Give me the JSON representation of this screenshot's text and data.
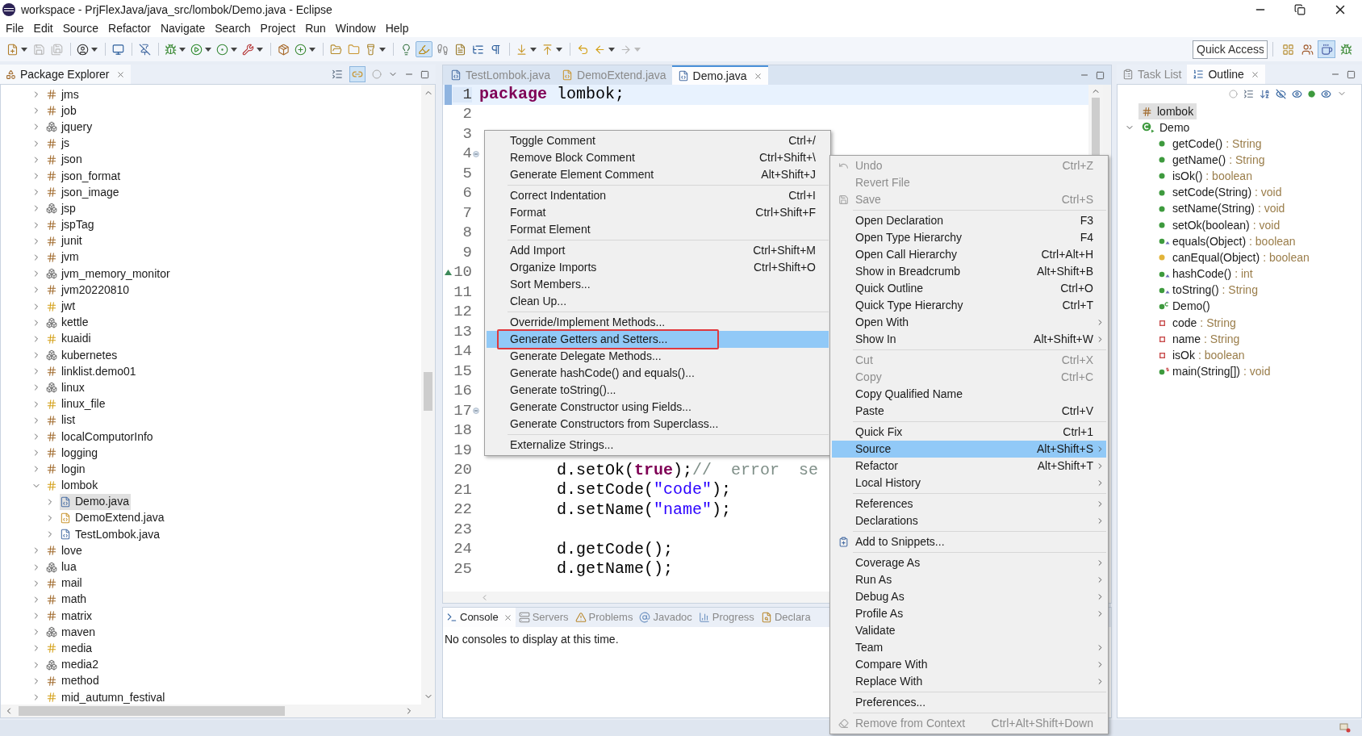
{
  "window": {
    "title": "workspace - PrjFlexJava/java_src/lombok/Demo.java - Eclipse"
  },
  "menu_bar": [
    "File",
    "Edit",
    "Source",
    "Refactor",
    "Navigate",
    "Search",
    "Project",
    "Run",
    "Window",
    "Help"
  ],
  "toolbar": [
    [
      {
        "kind": "new",
        "dropdown": true,
        "pressed": false,
        "disabled": false
      },
      {
        "kind": "save",
        "dropdown": false,
        "pressed": false,
        "disabled": true
      },
      {
        "kind": "save-all",
        "dropdown": false,
        "pressed": false,
        "disabled": true
      }
    ],
    [
      {
        "kind": "profile",
        "dropdown": true,
        "pressed": false,
        "disabled": false
      }
    ],
    [
      {
        "kind": "monitor",
        "dropdown": false,
        "pressed": false,
        "disabled": false
      }
    ],
    [
      {
        "kind": "skip",
        "dropdown": false,
        "pressed": false,
        "disabled": false
      }
    ],
    [
      {
        "kind": "debug",
        "dropdown": true,
        "pressed": false,
        "disabled": false
      },
      {
        "kind": "run",
        "dropdown": true,
        "pressed": false,
        "disabled": false
      },
      {
        "kind": "coverage",
        "dropdown": true,
        "pressed": false,
        "disabled": false
      },
      {
        "kind": "external",
        "dropdown": true,
        "pressed": false,
        "disabled": false
      }
    ],
    [
      {
        "kind": "package",
        "dropdown": false,
        "pressed": false,
        "disabled": false
      },
      {
        "kind": "class",
        "dropdown": true,
        "pressed": false,
        "disabled": false
      }
    ],
    [
      {
        "kind": "open-type",
        "dropdown": false,
        "pressed": false,
        "disabled": false
      },
      {
        "kind": "open-folder",
        "dropdown": false,
        "pressed": false,
        "disabled": false
      },
      {
        "kind": "search",
        "dropdown": true,
        "pressed": false,
        "disabled": false
      }
    ],
    [
      {
        "kind": "breadcrumb",
        "dropdown": false,
        "pressed": false,
        "disabled": false
      },
      {
        "kind": "mark",
        "dropdown": false,
        "pressed": true,
        "disabled": false
      },
      {
        "kind": "block",
        "dropdown": false,
        "pressed": false,
        "disabled": false
      },
      {
        "kind": "doc",
        "dropdown": false,
        "pressed": false,
        "disabled": false
      },
      {
        "kind": "list",
        "dropdown": false,
        "pressed": false,
        "disabled": false
      },
      {
        "kind": "whitespace",
        "dropdown": false,
        "pressed": false,
        "disabled": false
      }
    ],
    [
      {
        "kind": "next",
        "dropdown": true,
        "pressed": false,
        "disabled": false
      },
      {
        "kind": "prev",
        "dropdown": true,
        "pressed": false,
        "disabled": false
      }
    ],
    [
      {
        "kind": "last-edit",
        "dropdown": false,
        "pressed": false,
        "disabled": false
      },
      {
        "kind": "back",
        "dropdown": true,
        "pressed": false,
        "disabled": false
      },
      {
        "kind": "forward",
        "dropdown": true,
        "pressed": false,
        "disabled": true
      }
    ]
  ],
  "quick_access": {
    "placeholder": "Quick Access"
  },
  "perspectives": [
    {
      "kind": "open",
      "selected": false
    },
    {
      "kind": "javaee",
      "selected": false
    },
    {
      "kind": "java",
      "selected": true
    },
    {
      "kind": "debug",
      "selected": false
    }
  ],
  "explorer": {
    "title": "Package Explorer",
    "link_with_editor": true,
    "items": [
      {
        "label": "jms",
        "kind": "package",
        "expanded": false,
        "selected": false
      },
      {
        "label": "job",
        "kind": "package",
        "expanded": false,
        "selected": false
      },
      {
        "label": "jquery",
        "kind": "folder",
        "expanded": false,
        "selected": false
      },
      {
        "label": "js",
        "kind": "package",
        "expanded": false,
        "selected": false
      },
      {
        "label": "json",
        "kind": "package",
        "expanded": false,
        "selected": false
      },
      {
        "label": "json_format",
        "kind": "package",
        "expanded": false,
        "selected": false
      },
      {
        "label": "json_image",
        "kind": "package",
        "expanded": false,
        "selected": false
      },
      {
        "label": "jsp",
        "kind": "folder",
        "expanded": false,
        "selected": false
      },
      {
        "label": "jspTag",
        "kind": "package",
        "expanded": false,
        "selected": false
      },
      {
        "label": "junit",
        "kind": "package",
        "expanded": false,
        "selected": false
      },
      {
        "label": "jvm",
        "kind": "package",
        "expanded": false,
        "selected": false
      },
      {
        "label": "jvm_memory_monitor",
        "kind": "folder",
        "expanded": false,
        "selected": false
      },
      {
        "label": "jvm20220810",
        "kind": "package",
        "expanded": false,
        "selected": false
      },
      {
        "label": "jwt",
        "kind": "shared",
        "expanded": false,
        "selected": false
      },
      {
        "label": "kettle",
        "kind": "folder",
        "expanded": false,
        "selected": false
      },
      {
        "label": "kuaidi",
        "kind": "shared",
        "expanded": false,
        "selected": false
      },
      {
        "label": "kubernetes",
        "kind": "folder",
        "expanded": false,
        "selected": false
      },
      {
        "label": "linklist.demo01",
        "kind": "package",
        "expanded": false,
        "selected": false
      },
      {
        "label": "linux",
        "kind": "folder",
        "expanded": false,
        "selected": false
      },
      {
        "label": "linux_file",
        "kind": "shared",
        "expanded": false,
        "selected": false
      },
      {
        "label": "list",
        "kind": "package",
        "expanded": false,
        "selected": false
      },
      {
        "label": "localComputorInfo",
        "kind": "package",
        "expanded": false,
        "selected": false
      },
      {
        "label": "logging",
        "kind": "package",
        "expanded": false,
        "selected": false
      },
      {
        "label": "login",
        "kind": "package",
        "expanded": false,
        "selected": false
      },
      {
        "label": "lombok",
        "kind": "shared",
        "expanded": true,
        "selected": false,
        "children": [
          {
            "label": "Demo.java",
            "kind": "java",
            "expanded": false,
            "selected": true
          },
          {
            "label": "DemoExtend.java",
            "kind": "java-shared",
            "expanded": false,
            "selected": false
          },
          {
            "label": "TestLombok.java",
            "kind": "java",
            "expanded": false,
            "selected": false
          }
        ]
      },
      {
        "label": "love",
        "kind": "package",
        "expanded": false,
        "selected": false
      },
      {
        "label": "lua",
        "kind": "folder",
        "expanded": false,
        "selected": false
      },
      {
        "label": "mail",
        "kind": "package",
        "expanded": false,
        "selected": false
      },
      {
        "label": "math",
        "kind": "package",
        "expanded": false,
        "selected": false
      },
      {
        "label": "matrix",
        "kind": "package",
        "expanded": false,
        "selected": false
      },
      {
        "label": "maven",
        "kind": "folder",
        "expanded": false,
        "selected": false
      },
      {
        "label": "media",
        "kind": "shared",
        "expanded": false,
        "selected": false
      },
      {
        "label": "media2",
        "kind": "folder",
        "expanded": false,
        "selected": false
      },
      {
        "label": "method",
        "kind": "package",
        "expanded": false,
        "selected": false
      },
      {
        "label": "mid_autumn_festival",
        "kind": "shared",
        "expanded": false,
        "selected": false
      }
    ]
  },
  "editor": {
    "tabs": [
      {
        "label": "TestLombok.java",
        "kind": "java",
        "selected": false
      },
      {
        "label": "DemoExtend.java",
        "kind": "java-shared",
        "selected": false
      },
      {
        "label": "Demo.java",
        "kind": "java",
        "selected": true
      }
    ],
    "lines": [
      {
        "number": "1",
        "kind": "plain",
        "current": true,
        "tokens": [
          {
            "kind": "keyword",
            "text": "package"
          },
          {
            "kind": "plain",
            "text": " lombok;"
          }
        ]
      },
      {
        "number": "2",
        "kind": "plain",
        "current": false
      },
      {
        "number": "3",
        "kind": "plain",
        "current": false
      },
      {
        "number": "4",
        "kind": "fold",
        "current": false
      },
      {
        "number": "5",
        "kind": "plain",
        "current": false
      },
      {
        "number": "6",
        "kind": "plain",
        "current": false
      },
      {
        "number": "7",
        "kind": "plain",
        "current": false
      },
      {
        "number": "8",
        "kind": "plain",
        "current": false
      },
      {
        "number": "9",
        "kind": "plain",
        "current": false
      },
      {
        "number": "10",
        "kind": "override",
        "current": false
      },
      {
        "number": "11",
        "kind": "plain",
        "current": false
      },
      {
        "number": "12",
        "kind": "plain",
        "current": false
      },
      {
        "number": "13",
        "kind": "plain",
        "current": false
      },
      {
        "number": "14",
        "kind": "plain",
        "current": false
      },
      {
        "number": "15",
        "kind": "plain",
        "current": false
      },
      {
        "number": "16",
        "kind": "plain",
        "current": false
      },
      {
        "number": "17",
        "kind": "fold",
        "current": false
      },
      {
        "number": "18",
        "kind": "plain",
        "current": false
      },
      {
        "number": "19",
        "kind": "plain",
        "current": false
      },
      {
        "number": "20",
        "kind": "plain",
        "current": false,
        "tokens": [
          {
            "kind": "plain",
            "text": "        d.setOk("
          },
          {
            "kind": "keyword",
            "text": "true"
          },
          {
            "kind": "plain",
            "text": ");"
          },
          {
            "kind": "comment",
            "text": "//  error  se"
          }
        ]
      },
      {
        "number": "21",
        "kind": "plain",
        "current": false,
        "tokens": [
          {
            "kind": "plain",
            "text": "        d.setCode("
          },
          {
            "kind": "string",
            "text": "\"code\""
          },
          {
            "kind": "plain",
            "text": ");"
          }
        ]
      },
      {
        "number": "22",
        "kind": "plain",
        "current": false,
        "tokens": [
          {
            "kind": "plain",
            "text": "        d.setName("
          },
          {
            "kind": "string",
            "text": "\"name\""
          },
          {
            "kind": "plain",
            "text": ");"
          }
        ]
      },
      {
        "number": "23",
        "kind": "plain",
        "current": false
      },
      {
        "number": "24",
        "kind": "plain",
        "current": false,
        "tokens": [
          {
            "kind": "plain",
            "text": "        d.getCode();"
          }
        ]
      },
      {
        "number": "25",
        "kind": "plain",
        "current": false,
        "tokens": [
          {
            "kind": "plain",
            "text": "        d.getName();"
          }
        ]
      }
    ]
  },
  "console": {
    "tabs": [
      {
        "label": "Console",
        "kind": "console",
        "selected": true
      },
      {
        "label": "Servers",
        "kind": "servers",
        "selected": false
      },
      {
        "label": "Problems",
        "kind": "problems",
        "selected": false
      },
      {
        "label": "Javadoc",
        "kind": "javadoc",
        "selected": false
      },
      {
        "label": "Progress",
        "kind": "progress",
        "selected": false
      },
      {
        "label": "Declara",
        "kind": "declaration",
        "selected": false
      }
    ],
    "message": "No consoles to display at this time."
  },
  "outline": {
    "tabs": [
      {
        "label": "Task List",
        "kind": "tasks",
        "selected": false
      },
      {
        "label": "Outline",
        "kind": "outline",
        "selected": true
      }
    ],
    "tree": [
      {
        "label": "lombok",
        "kind": "package",
        "selected": true,
        "expanded": false
      },
      {
        "label": "Demo",
        "kind": "class",
        "selected": false,
        "expanded": true,
        "children": [
          {
            "name": "getCode()",
            "type": ": String",
            "kind": "public"
          },
          {
            "name": "getName()",
            "type": ": String",
            "kind": "public"
          },
          {
            "name": "isOk()",
            "type": ": boolean",
            "kind": "public"
          },
          {
            "name": "setCode(String)",
            "type": ": void",
            "kind": "public"
          },
          {
            "name": "setName(String)",
            "type": ": void",
            "kind": "public"
          },
          {
            "name": "setOk(boolean)",
            "type": ": void",
            "kind": "public"
          },
          {
            "name": "equals(Object)",
            "type": ": boolean",
            "kind": "override"
          },
          {
            "name": "canEqual(Object)",
            "type": ": boolean",
            "kind": "protected"
          },
          {
            "name": "hashCode()",
            "type": ": int",
            "kind": "override"
          },
          {
            "name": "toString()",
            "type": ": String",
            "kind": "override"
          },
          {
            "name": "Demo()",
            "kind": "constructor"
          },
          {
            "name": "code",
            "type": ": String",
            "kind": "field"
          },
          {
            "name": "name",
            "type": ": String",
            "kind": "field"
          },
          {
            "name": "isOk",
            "type": ": boolean",
            "kind": "field"
          },
          {
            "name": "main(String[])",
            "type": ": void",
            "kind": "static"
          }
        ]
      }
    ]
  },
  "source_menu": {
    "groups": [
      [
        {
          "label": "Toggle Comment",
          "shortcut": "Ctrl+/",
          "selected": false,
          "annotated": false
        },
        {
          "label": "Remove Block Comment",
          "shortcut": "Ctrl+Shift+\\",
          "selected": false,
          "annotated": false
        },
        {
          "label": "Generate Element Comment",
          "shortcut": "Alt+Shift+J",
          "selected": false,
          "annotated": false
        }
      ],
      [
        {
          "label": "Correct Indentation",
          "shortcut": "Ctrl+I",
          "selected": false,
          "annotated": false
        },
        {
          "label": "Format",
          "shortcut": "Ctrl+Shift+F",
          "selected": false,
          "annotated": false
        },
        {
          "label": "Format Element",
          "selected": false,
          "annotated": false
        }
      ],
      [
        {
          "label": "Add Import",
          "shortcut": "Ctrl+Shift+M",
          "selected": false,
          "annotated": false
        },
        {
          "label": "Organize Imports",
          "shortcut": "Ctrl+Shift+O",
          "selected": false,
          "annotated": false
        },
        {
          "label": "Sort Members...",
          "selected": false,
          "annotated": false
        },
        {
          "label": "Clean Up...",
          "selected": false,
          "annotated": false
        }
      ],
      [
        {
          "label": "Override/Implement Methods...",
          "selected": false,
          "annotated": false
        },
        {
          "label": "Generate Getters and Setters...",
          "selected": true,
          "annotated": true
        },
        {
          "label": "Generate Delegate Methods...",
          "selected": false,
          "annotated": false
        },
        {
          "label": "Generate hashCode() and equals()...",
          "selected": false,
          "annotated": false
        },
        {
          "label": "Generate toString()...",
          "selected": false,
          "annotated": false
        },
        {
          "label": "Generate Constructor using Fields...",
          "selected": false,
          "annotated": false
        },
        {
          "label": "Generate Constructors from Superclass...",
          "selected": false,
          "annotated": false
        }
      ],
      [
        {
          "label": "Externalize Strings...",
          "selected": false,
          "annotated": false
        }
      ]
    ]
  },
  "context_menu": {
    "groups": [
      [
        {
          "label": "Undo",
          "shortcut": "Ctrl+Z",
          "kind": "undo",
          "disabled": true,
          "selected": false,
          "submenu": false
        },
        {
          "label": "Revert File",
          "kind": "plain",
          "disabled": true,
          "selected": false,
          "submenu": false
        },
        {
          "label": "Save",
          "shortcut": "Ctrl+S",
          "kind": "save",
          "disabled": true,
          "selected": false,
          "submenu": false
        }
      ],
      [
        {
          "label": "Open Declaration",
          "shortcut": "F3",
          "kind": "plain",
          "disabled": false,
          "selected": false,
          "submenu": false
        },
        {
          "label": "Open Type Hierarchy",
          "shortcut": "F4",
          "kind": "plain",
          "disabled": false,
          "selected": false,
          "submenu": false
        },
        {
          "label": "Open Call Hierarchy",
          "shortcut": "Ctrl+Alt+H",
          "kind": "plain",
          "disabled": false,
          "selected": false,
          "submenu": false
        },
        {
          "label": "Show in Breadcrumb",
          "shortcut": "Alt+Shift+B",
          "kind": "plain",
          "disabled": false,
          "selected": false,
          "submenu": false
        },
        {
          "label": "Quick Outline",
          "shortcut": "Ctrl+O",
          "kind": "plain",
          "disabled": false,
          "selected": false,
          "submenu": false
        },
        {
          "label": "Quick Type Hierarchy",
          "shortcut": "Ctrl+T",
          "kind": "plain",
          "disabled": false,
          "selected": false,
          "submenu": false
        },
        {
          "label": "Open With",
          "kind": "plain",
          "disabled": false,
          "selected": false,
          "submenu": true
        },
        {
          "label": "Show In",
          "shortcut": "Alt+Shift+W",
          "kind": "plain",
          "disabled": false,
          "selected": false,
          "submenu": true
        }
      ],
      [
        {
          "label": "Cut",
          "shortcut": "Ctrl+X",
          "kind": "plain",
          "disabled": true,
          "selected": false,
          "submenu": false
        },
        {
          "label": "Copy",
          "shortcut": "Ctrl+C",
          "kind": "plain",
          "disabled": true,
          "selected": false,
          "submenu": false
        },
        {
          "label": "Copy Qualified Name",
          "kind": "plain",
          "disabled": false,
          "selected": false,
          "submenu": false
        },
        {
          "label": "Paste",
          "shortcut": "Ctrl+V",
          "kind": "plain",
          "disabled": false,
          "selected": false,
          "submenu": false
        }
      ],
      [
        {
          "label": "Quick Fix",
          "shortcut": "Ctrl+1",
          "kind": "plain",
          "disabled": false,
          "selected": false,
          "submenu": false
        },
        {
          "label": "Source",
          "shortcut": "Alt+Shift+S",
          "kind": "plain",
          "disabled": false,
          "selected": true,
          "submenu": true
        },
        {
          "label": "Refactor",
          "shortcut": "Alt+Shift+T",
          "kind": "plain",
          "disabled": false,
          "selected": false,
          "submenu": true
        },
        {
          "label": "Local History",
          "kind": "plain",
          "disabled": false,
          "selected": false,
          "submenu": true
        }
      ],
      [
        {
          "label": "References",
          "kind": "plain",
          "disabled": false,
          "selected": false,
          "submenu": true
        },
        {
          "label": "Declarations",
          "kind": "plain",
          "disabled": false,
          "selected": false,
          "submenu": true
        }
      ],
      [
        {
          "label": "Add to Snippets...",
          "kind": "snippet",
          "disabled": false,
          "selected": false,
          "submenu": false
        }
      ],
      [
        {
          "label": "Coverage As",
          "kind": "plain",
          "disabled": false,
          "selected": false,
          "submenu": true
        },
        {
          "label": "Run As",
          "kind": "plain",
          "disabled": false,
          "selected": false,
          "submenu": true
        },
        {
          "label": "Debug As",
          "kind": "plain",
          "disabled": false,
          "selected": false,
          "submenu": true
        },
        {
          "label": "Profile As",
          "kind": "plain",
          "disabled": false,
          "selected": false,
          "submenu": true
        },
        {
          "label": "Validate",
          "kind": "plain",
          "disabled": false,
          "selected": false,
          "submenu": false
        },
        {
          "label": "Team",
          "kind": "plain",
          "disabled": false,
          "selected": false,
          "submenu": true
        },
        {
          "label": "Compare With",
          "kind": "plain",
          "disabled": false,
          "selected": false,
          "submenu": true
        },
        {
          "label": "Replace With",
          "kind": "plain",
          "disabled": false,
          "selected": false,
          "submenu": true
        }
      ],
      [
        {
          "label": "Preferences...",
          "kind": "plain",
          "disabled": false,
          "selected": false,
          "submenu": false
        }
      ],
      [
        {
          "label": "Remove from Context",
          "shortcut": "Ctrl+Alt+Shift+Down",
          "kind": "context",
          "disabled": true,
          "selected": false,
          "submenu": false
        }
      ]
    ]
  }
}
